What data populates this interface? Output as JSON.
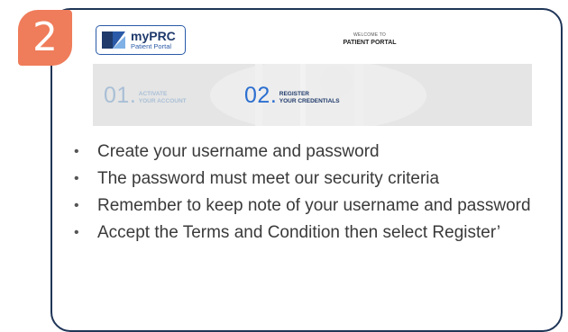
{
  "step_badge": {
    "number": "2"
  },
  "logo": {
    "name": "myPRC",
    "subtitle": "Patient Portal"
  },
  "welcome": {
    "small": "WELCOME TO",
    "title": "PATIENT PORTAL"
  },
  "steps": [
    {
      "number": "01",
      "dot": ".",
      "line1": "ACTIVATE",
      "line2": "YOUR ACCOUNT"
    },
    {
      "number": "02",
      "dot": ".",
      "line1": "REGISTER",
      "line2": "YOUR CREDENTIALS"
    }
  ],
  "instructions": [
    "Create your username and password",
    "The password must meet our security criteria",
    "Remember to keep note of your username and password",
    "Accept the Terms and Condition then select Register’"
  ],
  "colors": {
    "badge": "#ef7c5a",
    "card_border": "#1f3557",
    "active_step": "#2c6fd0",
    "inactive_step": "#a9bfd6"
  }
}
